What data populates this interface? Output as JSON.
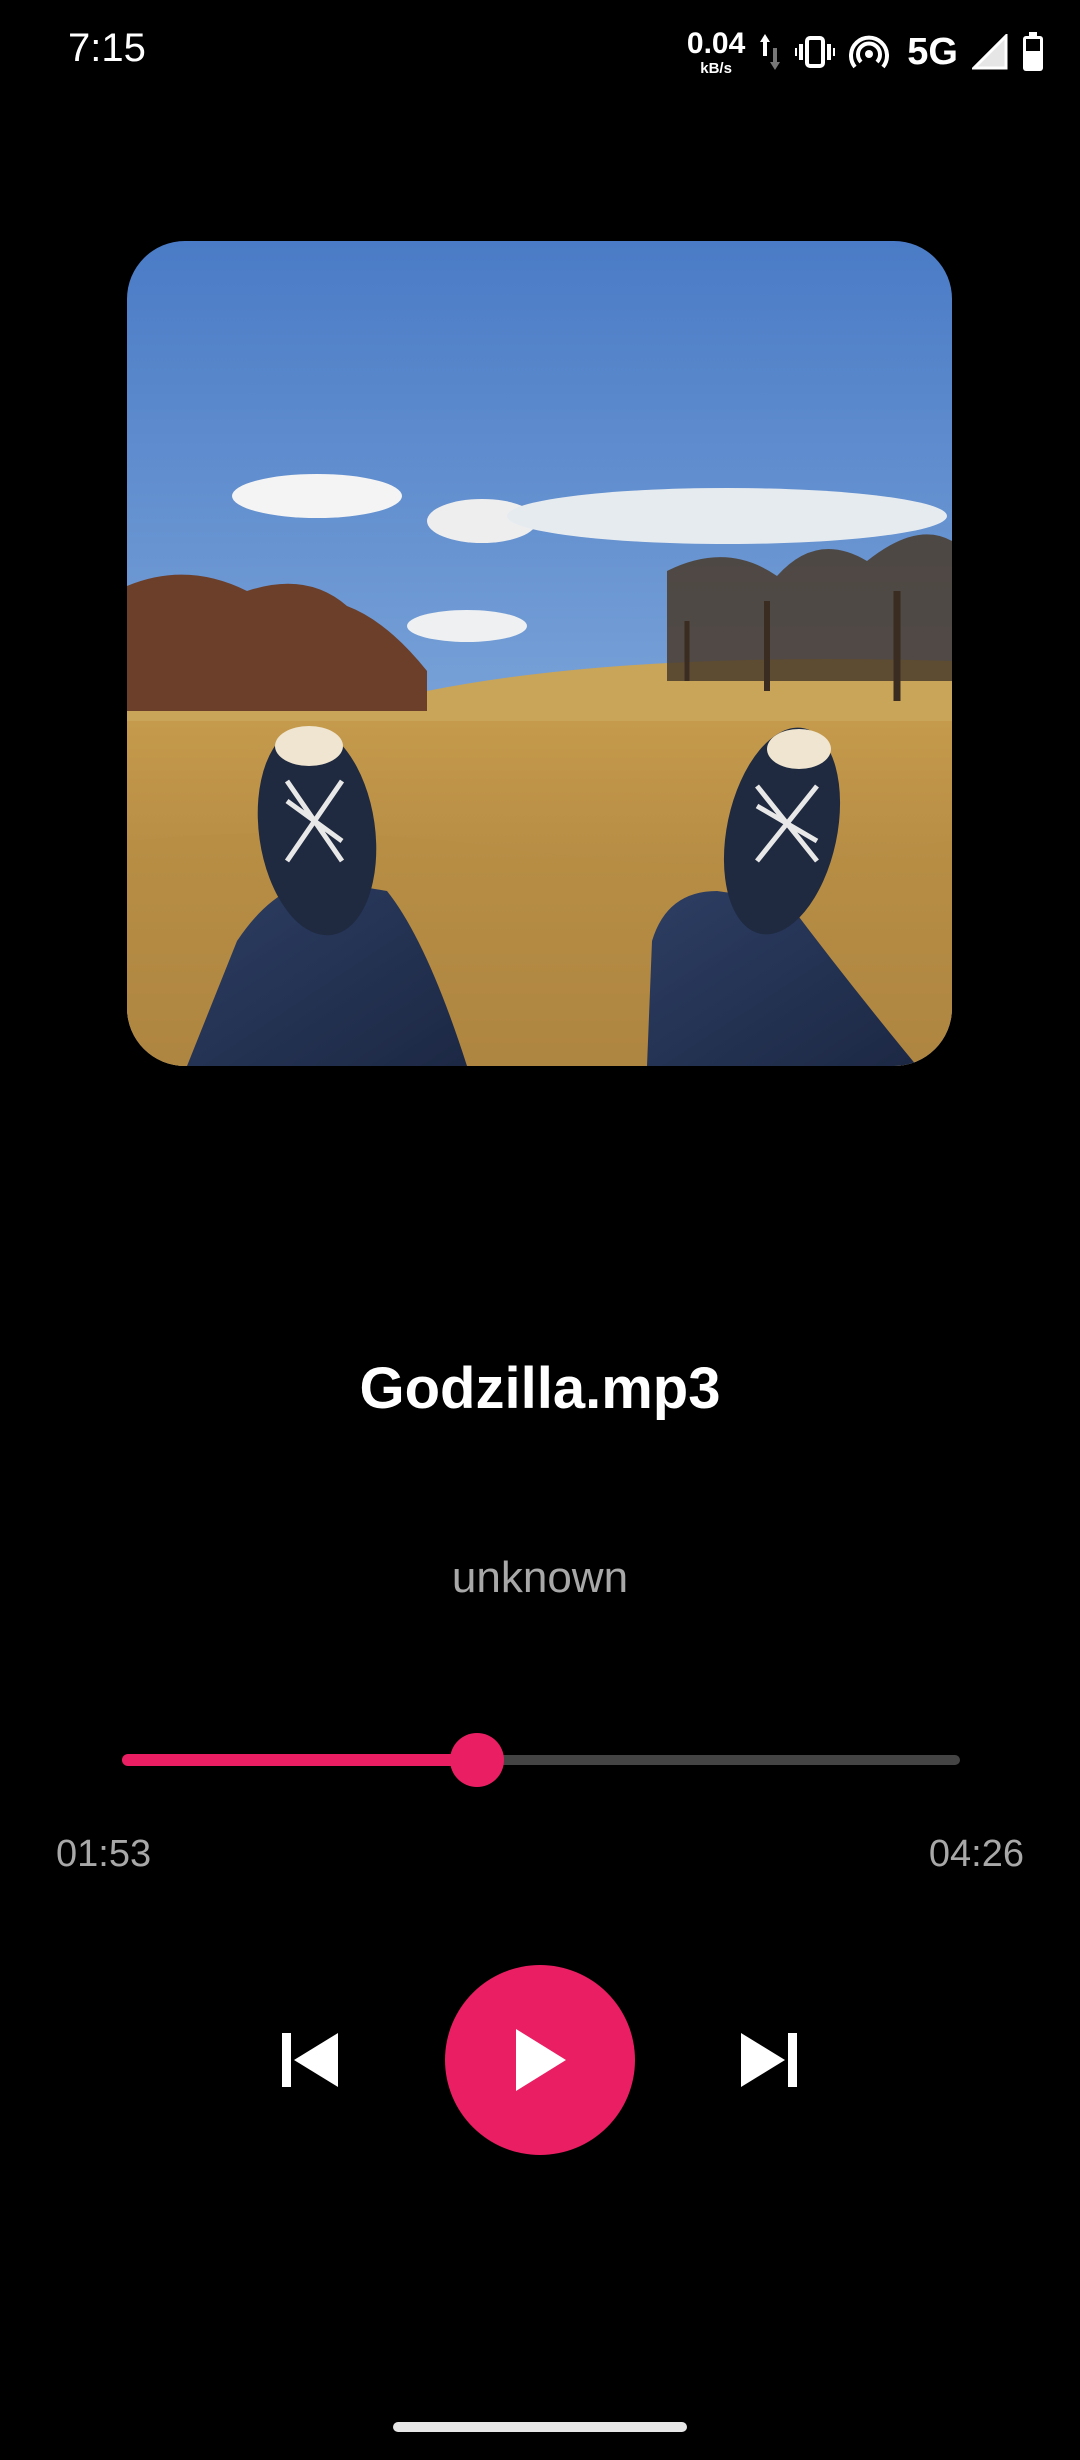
{
  "status_bar": {
    "time": "7:15",
    "net_speed_value": "0.04",
    "net_speed_unit": "kB/s",
    "network_label": "5G",
    "icons": [
      "upload-download-arrows-icon",
      "vibrate-icon",
      "hotspot-icon",
      "signal-icon",
      "battery-icon"
    ]
  },
  "player": {
    "album_art": "album-art-image",
    "title": "Godzilla.mp3",
    "artist": "unknown",
    "elapsed": "01:53",
    "duration": "04:26",
    "progress": 0.424,
    "accent_color": "#e91e63"
  },
  "controls": {
    "previous": "skip-previous-icon",
    "play": "play-icon",
    "next": "skip-next-icon"
  }
}
